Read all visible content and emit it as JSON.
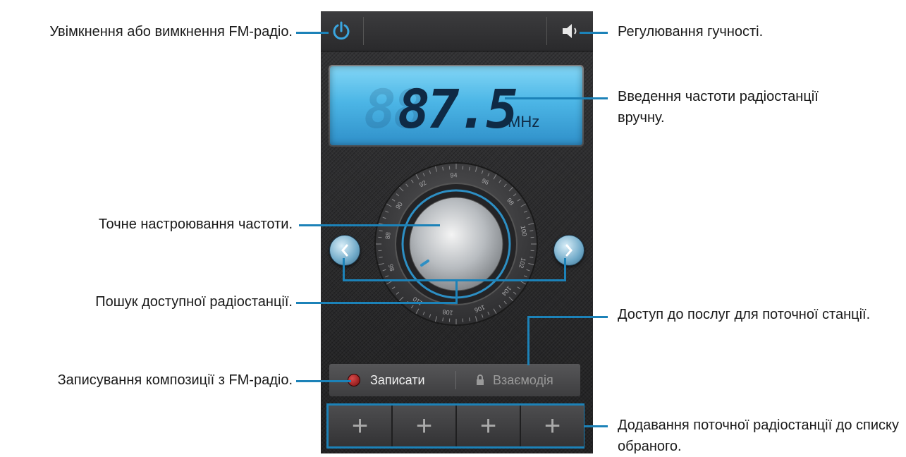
{
  "frequency": "87.5",
  "frequency_ghost": "88",
  "unit": "MHz",
  "dial_scale": [
    "86",
    "88",
    "90",
    "92",
    "94",
    "96",
    "98",
    "100",
    "102",
    "104",
    "106",
    "108",
    "110"
  ],
  "buttons": {
    "record": "Записати",
    "interact": "Взаємодія"
  },
  "favorites": [
    "+",
    "+",
    "+",
    "+"
  ],
  "callouts": {
    "power": "Увімкнення або вимкнення FM-радіо.",
    "volume": "Регулювання гучності.",
    "manual_freq": "Введення частоти радіостанції вручну.",
    "fine_tune": "Точне настроювання частоти.",
    "search": "Пошук доступної радіостанції.",
    "services": "Доступ до послуг для поточної станції.",
    "record": "Записування композиції з FM-радіо.",
    "add_fav": "Додавання поточної радіостанції до списку обраного."
  },
  "colors": {
    "accent": "#1c82b8",
    "lcd": "#4cb6e6",
    "record": "#b52020"
  },
  "icons": [
    "power-icon",
    "volume-icon",
    "chevron-left-icon",
    "chevron-right-icon",
    "record-icon",
    "lock-icon",
    "plus-icon"
  ]
}
